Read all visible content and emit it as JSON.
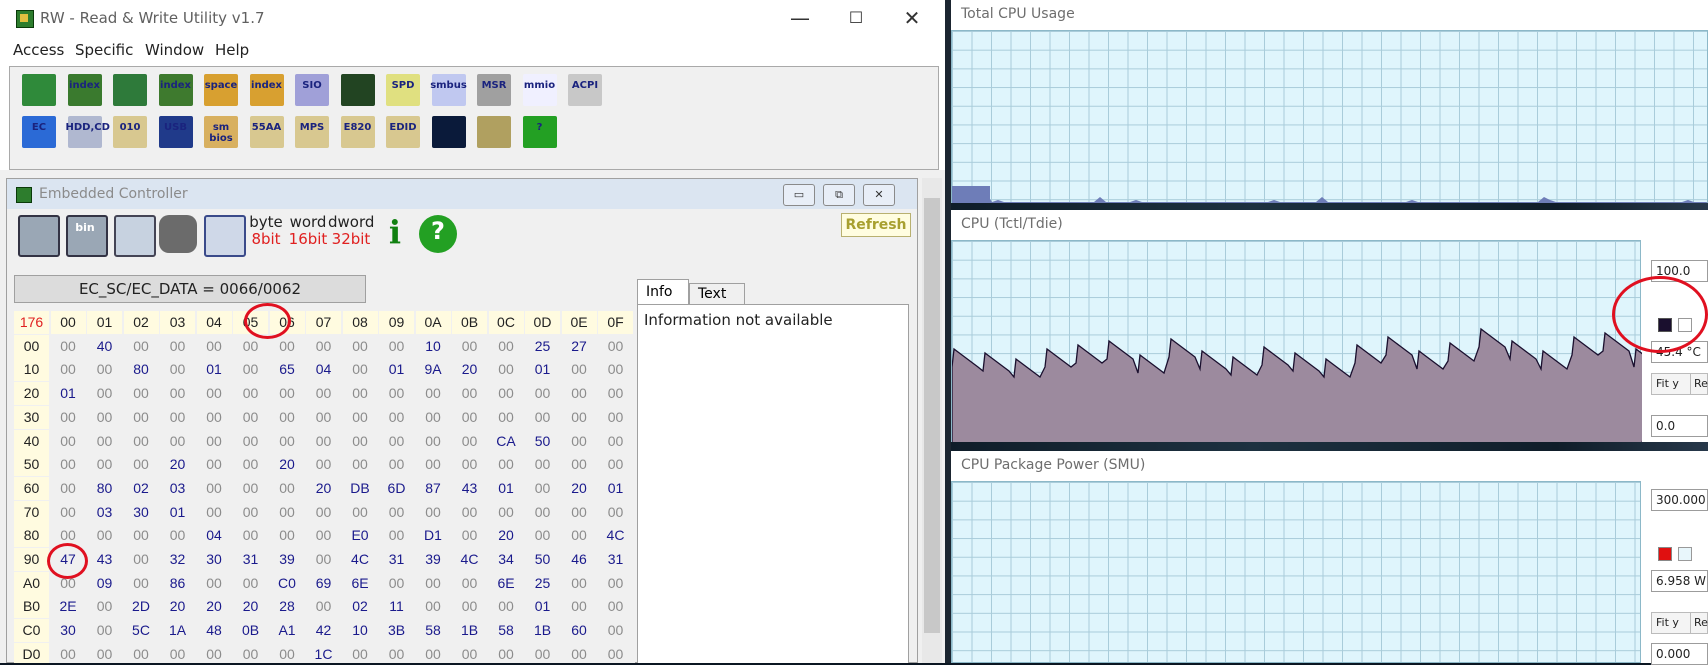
{
  "rw_window": {
    "title": "RW - Read & Write Utility v1.7",
    "minimize_glyph": "—",
    "maximize_glyph": "☐",
    "close_glyph": "✕",
    "menu": [
      "Access",
      "Specific",
      "Window",
      "Help"
    ],
    "toolbar_row1": [
      {
        "icon": "pci-card-icon",
        "label": ""
      },
      {
        "icon": "pci-index-icon",
        "label": "index"
      },
      {
        "icon": "memory-icon",
        "label": ""
      },
      {
        "icon": "memory-index-icon",
        "label": "index"
      },
      {
        "icon": "io-space-icon",
        "label": "space"
      },
      {
        "icon": "io-index-icon",
        "label": "index"
      },
      {
        "icon": "sio-icon",
        "label": "SIO"
      },
      {
        "icon": "oscilloscope-icon",
        "label": ""
      },
      {
        "icon": "spd-icon",
        "label": "SPD"
      },
      {
        "icon": "smbus-icon",
        "label": "smbus"
      },
      {
        "icon": "msr-icon",
        "label": "MSR"
      },
      {
        "icon": "mmio-icon",
        "label": "mmio"
      },
      {
        "icon": "acpi-icon",
        "label": "ACPI"
      }
    ],
    "toolbar_row2": [
      {
        "icon": "ec-icon",
        "label": "EC"
      },
      {
        "icon": "hdd-cd-icon",
        "label": "HDD,CD"
      },
      {
        "icon": "disk-010-icon",
        "label": "010"
      },
      {
        "icon": "usb-icon",
        "label": "USB"
      },
      {
        "icon": "smbios-icon",
        "label": "sm bios"
      },
      {
        "icon": "55aa-icon",
        "label": "55AA"
      },
      {
        "icon": "mps-icon",
        "label": "MPS"
      },
      {
        "icon": "e820-icon",
        "label": "E820"
      },
      {
        "icon": "edid-icon",
        "label": "EDID"
      },
      {
        "icon": "command-prompt-icon",
        "label": ""
      },
      {
        "icon": "device-icon",
        "label": ""
      },
      {
        "icon": "help-icon",
        "label": "?"
      }
    ]
  },
  "ec_window": {
    "title": "Embedded Controller",
    "min_glyph": "▭",
    "restore_glyph": "⧉",
    "close_glyph": "✕",
    "tools": [
      {
        "icon": "save-icon",
        "label": ""
      },
      {
        "icon": "save-bin-icon",
        "label": "bin"
      },
      {
        "icon": "load-icon",
        "label": ""
      },
      {
        "icon": "binoculars-icon",
        "label": ""
      },
      {
        "icon": "grid-icon",
        "label": ""
      }
    ],
    "bit_buttons": [
      {
        "top": "byte",
        "bottom": "8bit",
        "color": "#e02020"
      },
      {
        "top": "word",
        "bottom": "16bit",
        "color": "#e02020"
      },
      {
        "top": "dword",
        "bottom": "32bit",
        "color": "#e02020"
      }
    ],
    "info_icon": "i",
    "help_icon": "?",
    "refresh_label": "Refresh",
    "ec_sc_label": "EC_SC/EC_DATA = 0066/0062",
    "hex_corner": "176",
    "hex_columns": [
      "00",
      "01",
      "02",
      "03",
      "04",
      "05",
      "06",
      "07",
      "08",
      "09",
      "0A",
      "0B",
      "0C",
      "0D",
      "0E",
      "0F"
    ],
    "hex_rows": [
      {
        "label": "00",
        "values": [
          "00",
          "40",
          "00",
          "00",
          "00",
          "00",
          "00",
          "00",
          "00",
          "00",
          "10",
          "00",
          "00",
          "25",
          "27",
          "00"
        ]
      },
      {
        "label": "10",
        "values": [
          "00",
          "00",
          "80",
          "00",
          "01",
          "00",
          "65",
          "04",
          "00",
          "01",
          "9A",
          "20",
          "00",
          "01",
          "00",
          "00"
        ]
      },
      {
        "label": "20",
        "values": [
          "01",
          "00",
          "00",
          "00",
          "00",
          "00",
          "00",
          "00",
          "00",
          "00",
          "00",
          "00",
          "00",
          "00",
          "00",
          "00"
        ]
      },
      {
        "label": "30",
        "values": [
          "00",
          "00",
          "00",
          "00",
          "00",
          "00",
          "00",
          "00",
          "00",
          "00",
          "00",
          "00",
          "00",
          "00",
          "00",
          "00"
        ]
      },
      {
        "label": "40",
        "values": [
          "00",
          "00",
          "00",
          "00",
          "00",
          "00",
          "00",
          "00",
          "00",
          "00",
          "00",
          "00",
          "CA",
          "50",
          "00",
          "00"
        ]
      },
      {
        "label": "50",
        "values": [
          "00",
          "00",
          "00",
          "20",
          "00",
          "00",
          "20",
          "00",
          "00",
          "00",
          "00",
          "00",
          "00",
          "00",
          "00",
          "00"
        ]
      },
      {
        "label": "60",
        "values": [
          "00",
          "80",
          "02",
          "03",
          "00",
          "00",
          "00",
          "20",
          "DB",
          "6D",
          "87",
          "43",
          "01",
          "00",
          "20",
          "01"
        ]
      },
      {
        "label": "70",
        "values": [
          "00",
          "03",
          "30",
          "01",
          "00",
          "00",
          "00",
          "00",
          "00",
          "00",
          "00",
          "00",
          "00",
          "00",
          "00",
          "00"
        ]
      },
      {
        "label": "80",
        "values": [
          "00",
          "00",
          "00",
          "00",
          "04",
          "00",
          "00",
          "00",
          "E0",
          "00",
          "D1",
          "00",
          "20",
          "00",
          "00",
          "4C"
        ]
      },
      {
        "label": "90",
        "values": [
          "47",
          "43",
          "00",
          "32",
          "30",
          "31",
          "39",
          "00",
          "4C",
          "31",
          "39",
          "4C",
          "34",
          "50",
          "46",
          "31"
        ]
      },
      {
        "label": "A0",
        "values": [
          "00",
          "09",
          "00",
          "86",
          "00",
          "00",
          "C0",
          "69",
          "6E",
          "00",
          "00",
          "00",
          "6E",
          "25",
          "00",
          "00"
        ]
      },
      {
        "label": "B0",
        "values": [
          "2E",
          "00",
          "2D",
          "20",
          "20",
          "20",
          "28",
          "00",
          "02",
          "11",
          "00",
          "00",
          "00",
          "01",
          "00",
          "00"
        ]
      },
      {
        "label": "C0",
        "values": [
          "30",
          "00",
          "5C",
          "1A",
          "48",
          "0B",
          "A1",
          "42",
          "10",
          "3B",
          "58",
          "1B",
          "58",
          "1B",
          "60",
          "00"
        ]
      },
      {
        "label": "D0",
        "values": [
          "00",
          "00",
          "00",
          "00",
          "00",
          "00",
          "00",
          "1C",
          "00",
          "00",
          "00",
          "00",
          "00",
          "00",
          "00",
          "00"
        ]
      }
    ],
    "tabs": [
      "Info",
      "Text"
    ],
    "info_text": "Information not available"
  },
  "monitor": {
    "total_cpu": {
      "title": "Total CPU Usage"
    },
    "cpu_temp": {
      "title": "CPU (Tctl/Tdie)",
      "max": "100.0",
      "value": "45.4 °C",
      "min": "0.0",
      "fit_label": "Fit y",
      "reset_label": "Re",
      "line_color": "#1a0f2e",
      "fill_color": "#9c8a9e"
    },
    "cpu_power": {
      "title": "CPU Package Power (SMU)",
      "max": "300.000",
      "value": "6.958 W",
      "min": "0.000",
      "fit_label": "Fit y",
      "reset_label": "Re",
      "swatch_color": "#e01010"
    }
  },
  "colors": {
    "hex_zero": "#8c8c8c",
    "hex_nonzero": "#1a1a8c",
    "annotation": "#e01020"
  }
}
